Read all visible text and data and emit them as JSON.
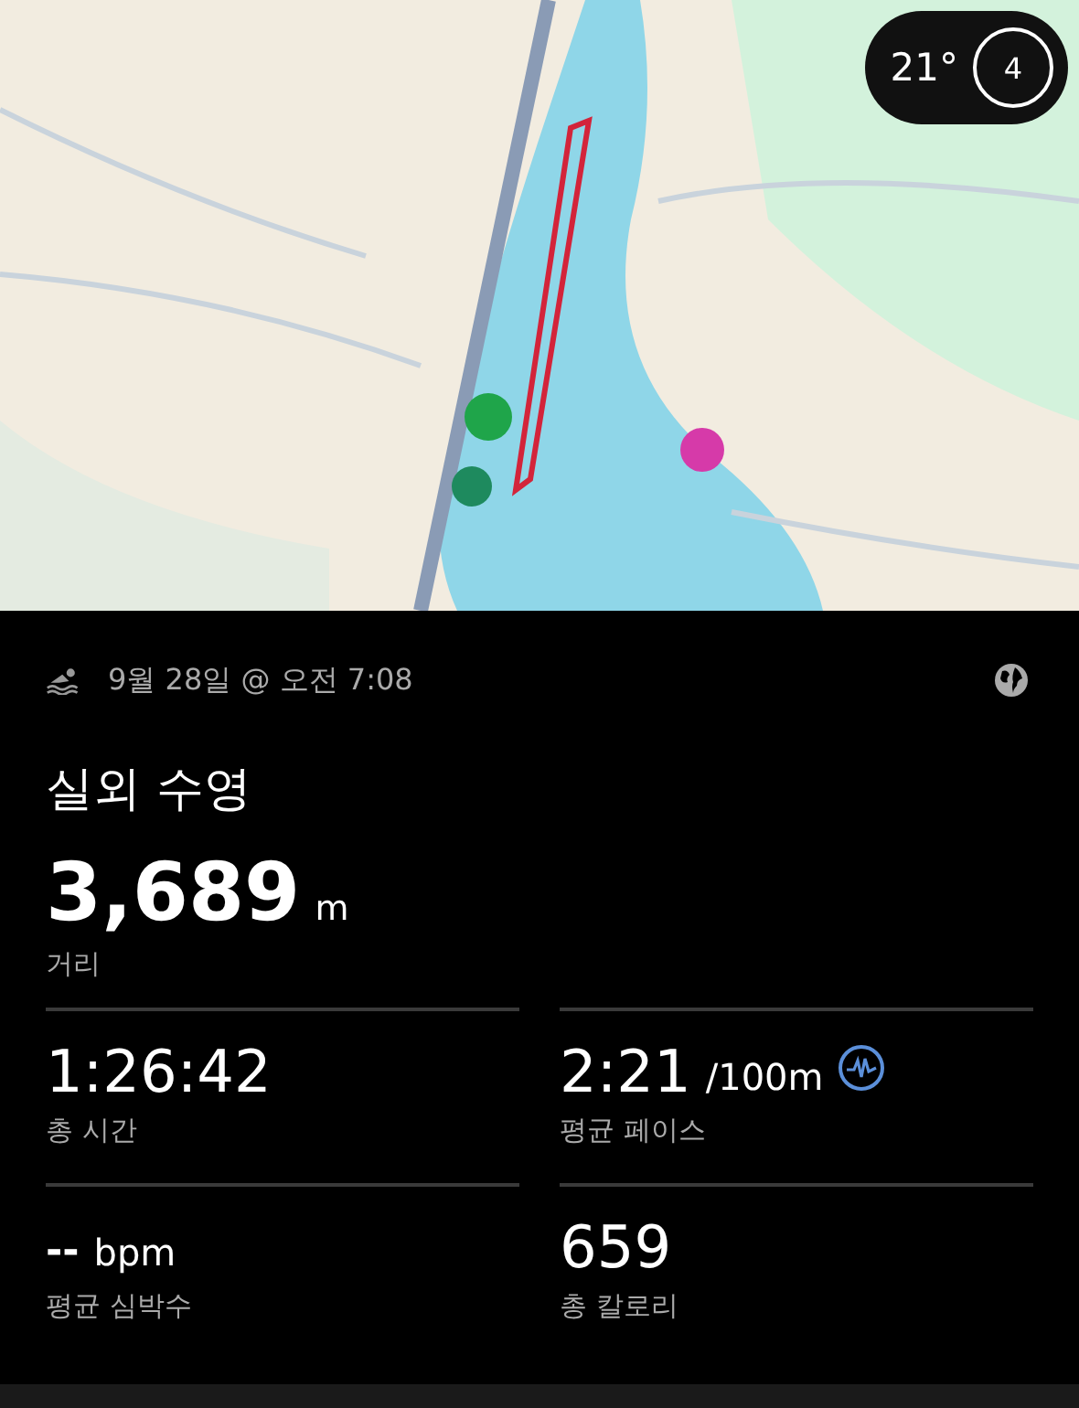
{
  "map": {
    "kind": "picture",
    "weather": {
      "temperature": "21°",
      "wind": "4"
    }
  },
  "header": {
    "date": "9월 28일 @ 오전 7:08"
  },
  "activity": {
    "title": "실외 수영",
    "distance": {
      "value": "3,689",
      "unit": "m",
      "label": "거리"
    }
  },
  "stats": [
    {
      "value": "1:26:42",
      "label": "총 시간",
      "kind": "plain"
    },
    {
      "value": "2:21",
      "unit": "/100m",
      "label": "평균 페이스",
      "kind": "chart-link"
    },
    {
      "value": "--",
      "unit": "bpm",
      "label": "평균 심박수",
      "kind": "small"
    },
    {
      "value": "659",
      "label": "총 칼로리",
      "kind": "plain"
    }
  ]
}
